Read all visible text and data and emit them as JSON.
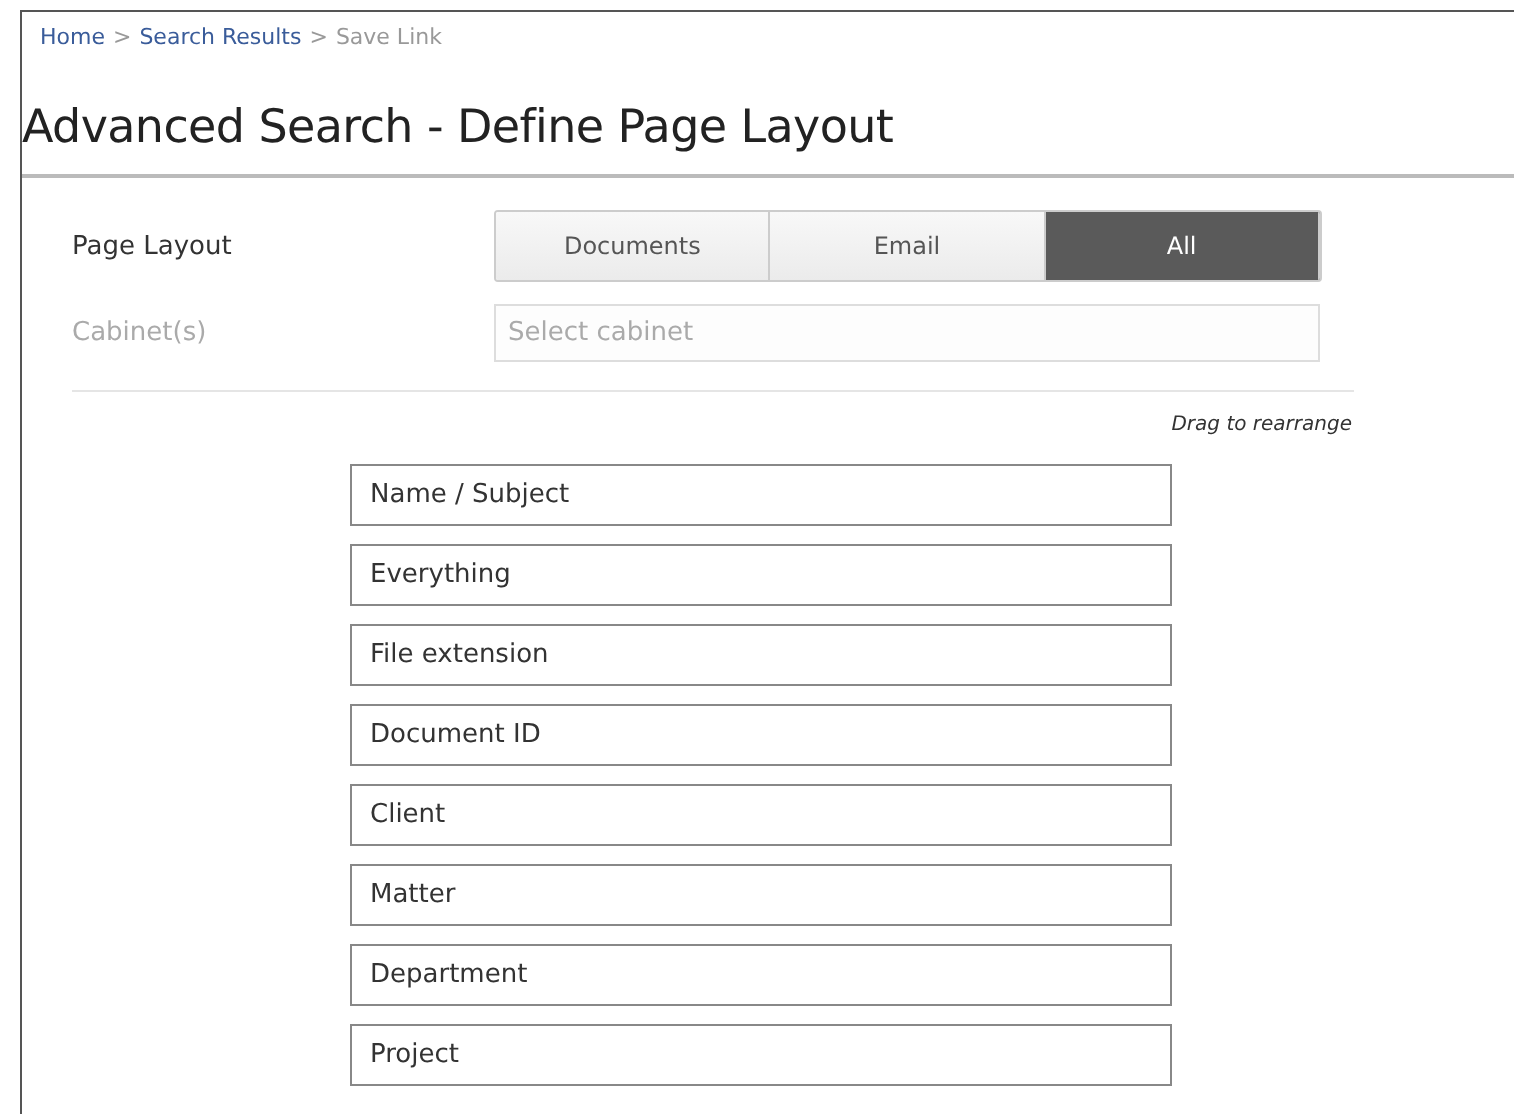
{
  "breadcrumb_separator": ">",
  "breadcrumb": [
    {
      "label": "Home",
      "kind": "link"
    },
    {
      "label": "Search Results",
      "kind": "link"
    },
    {
      "label": "Save Link",
      "kind": "current"
    }
  ],
  "title": "Advanced Search - Define Page Layout",
  "page_layout": {
    "label": "Page Layout",
    "options": [
      {
        "label": "Documents",
        "selected": false
      },
      {
        "label": "Email",
        "selected": false
      },
      {
        "label": "All",
        "selected": true
      }
    ]
  },
  "cabinet": {
    "label": "Cabinet(s)",
    "placeholder": "Select cabinet",
    "disabled": true
  },
  "hint": "Drag to rearrange",
  "fields": [
    "Name / Subject",
    "Everything",
    "File extension",
    "Document ID",
    "Client",
    "Matter",
    "Department",
    "Project"
  ]
}
